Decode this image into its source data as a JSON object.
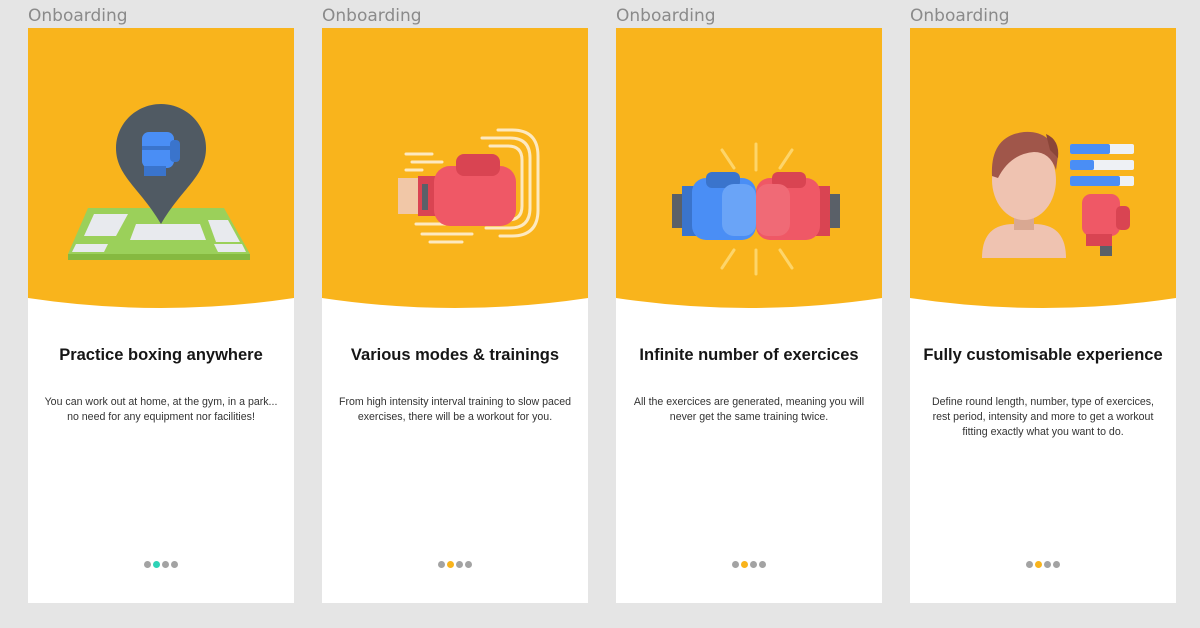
{
  "colors": {
    "background": "#e5e5e5",
    "hero": "#f9b41c",
    "dot_inactive": "#a3a3a3",
    "dot_active_first": "#2ed3b7",
    "dot_active": "#f9b41c"
  },
  "screens": [
    {
      "frame_label": "Onboarding",
      "illustration": "map-pin-boxing-glove-icon",
      "title": "Practice boxing anywhere",
      "description": "You can work out at home, at the gym, in a park... no need for any equipment nor facilities!",
      "pagination": {
        "total": 4,
        "active": 2
      }
    },
    {
      "frame_label": "Onboarding",
      "illustration": "punching-glove-icon",
      "title": "Various modes & trainings",
      "description": "From high intensity interval training to slow paced exercises, there will be a workout for you.",
      "pagination": {
        "total": 4,
        "active": 2
      }
    },
    {
      "frame_label": "Onboarding",
      "illustration": "gloves-bump-icon",
      "title": "Infinite number of exercices",
      "description": "All the exercices are generated, meaning you will never get the same training twice.",
      "pagination": {
        "total": 4,
        "active": 2
      }
    },
    {
      "frame_label": "Onboarding",
      "illustration": "boxer-profile-icon",
      "title": "Fully customisable experience",
      "description": "Define round length, number, type of exercices, rest period, intensity and more to get a workout fitting exactly what you want to do.",
      "pagination": {
        "total": 4,
        "active": 2
      }
    }
  ]
}
